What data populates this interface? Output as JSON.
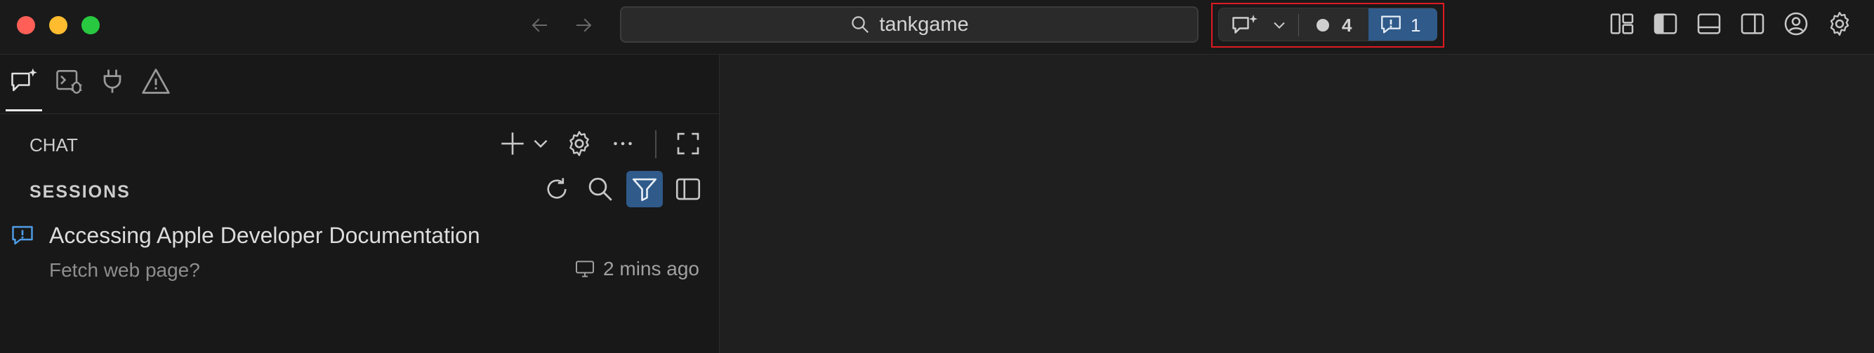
{
  "titlebar": {
    "search_text": "tankgame",
    "icons": [
      "back-arrow-icon",
      "forward-arrow-icon",
      "search-icon",
      "layout-customize-icon",
      "toggle-primary-sidebar-icon",
      "toggle-panel-icon",
      "toggle-secondary-sidebar-icon",
      "account-icon",
      "manage-gear-icon"
    ]
  },
  "chat_control": {
    "icon": "chat-sparkle-icon",
    "dropdown_icon": "chevron-down-icon",
    "count_sessions": "4",
    "count_attention": "1",
    "highlight_color": "#e01a22",
    "active_color": "#2f5a8a"
  },
  "sidebar": {
    "tabs": [
      "chat-sparkle-icon",
      "debug-console-icon",
      "plug-icon",
      "warning-icon"
    ],
    "chat_label": "CHAT",
    "sessions_label": "SESSIONS",
    "chat_actions": [
      "new-chat-plus-icon",
      "chevron-down-icon",
      "settings-gear-icon",
      "more-ellipsis-icon",
      "maximize-icon"
    ],
    "session_actions": [
      "refresh-icon",
      "search-icon",
      "filter-icon",
      "split-view-icon"
    ],
    "sessions": [
      {
        "title": "Accessing Apple Developer Documentation",
        "subtitle": "Fetch web page?",
        "meta_icon": "monitor-icon",
        "time": "2 mins ago"
      }
    ]
  }
}
